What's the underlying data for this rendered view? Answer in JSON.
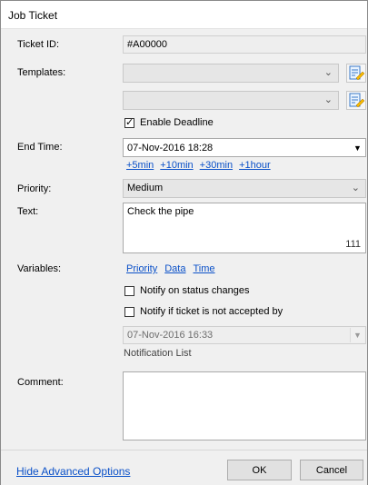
{
  "window": {
    "title": "Job Ticket"
  },
  "labels": {
    "ticket_id": "Ticket ID:",
    "templates": "Templates:",
    "end_time": "End Time:",
    "priority": "Priority:",
    "text": "Text:",
    "variables": "Variables:",
    "comment": "Comment:"
  },
  "ticket_id_value": "#A00000",
  "enable_deadline": {
    "label": "Enable Deadline",
    "checked": true
  },
  "end_time": {
    "value": "07-Nov-2016 18:28",
    "quick": [
      "+5min",
      "+10min",
      "+30min",
      "+1hour"
    ]
  },
  "priority": {
    "selected": "Medium"
  },
  "text": {
    "value": "Check the pipe",
    "char_count": "111"
  },
  "variables": [
    "Priority",
    "Data",
    "Time"
  ],
  "notify_status": {
    "label": "Notify on status changes",
    "checked": false
  },
  "notify_accept": {
    "label": "Notify if ticket is not accepted by",
    "checked": false
  },
  "accept_time": "07-Nov-2016 16:33",
  "notification_list_label": "Notification List",
  "comment": {
    "value": ""
  },
  "footer": {
    "advanced_link": "Hide Advanced Options",
    "ok": "OK",
    "cancel": "Cancel"
  },
  "colors": {
    "link": "#0a50c8",
    "window_bg": "#f0f0f0"
  }
}
